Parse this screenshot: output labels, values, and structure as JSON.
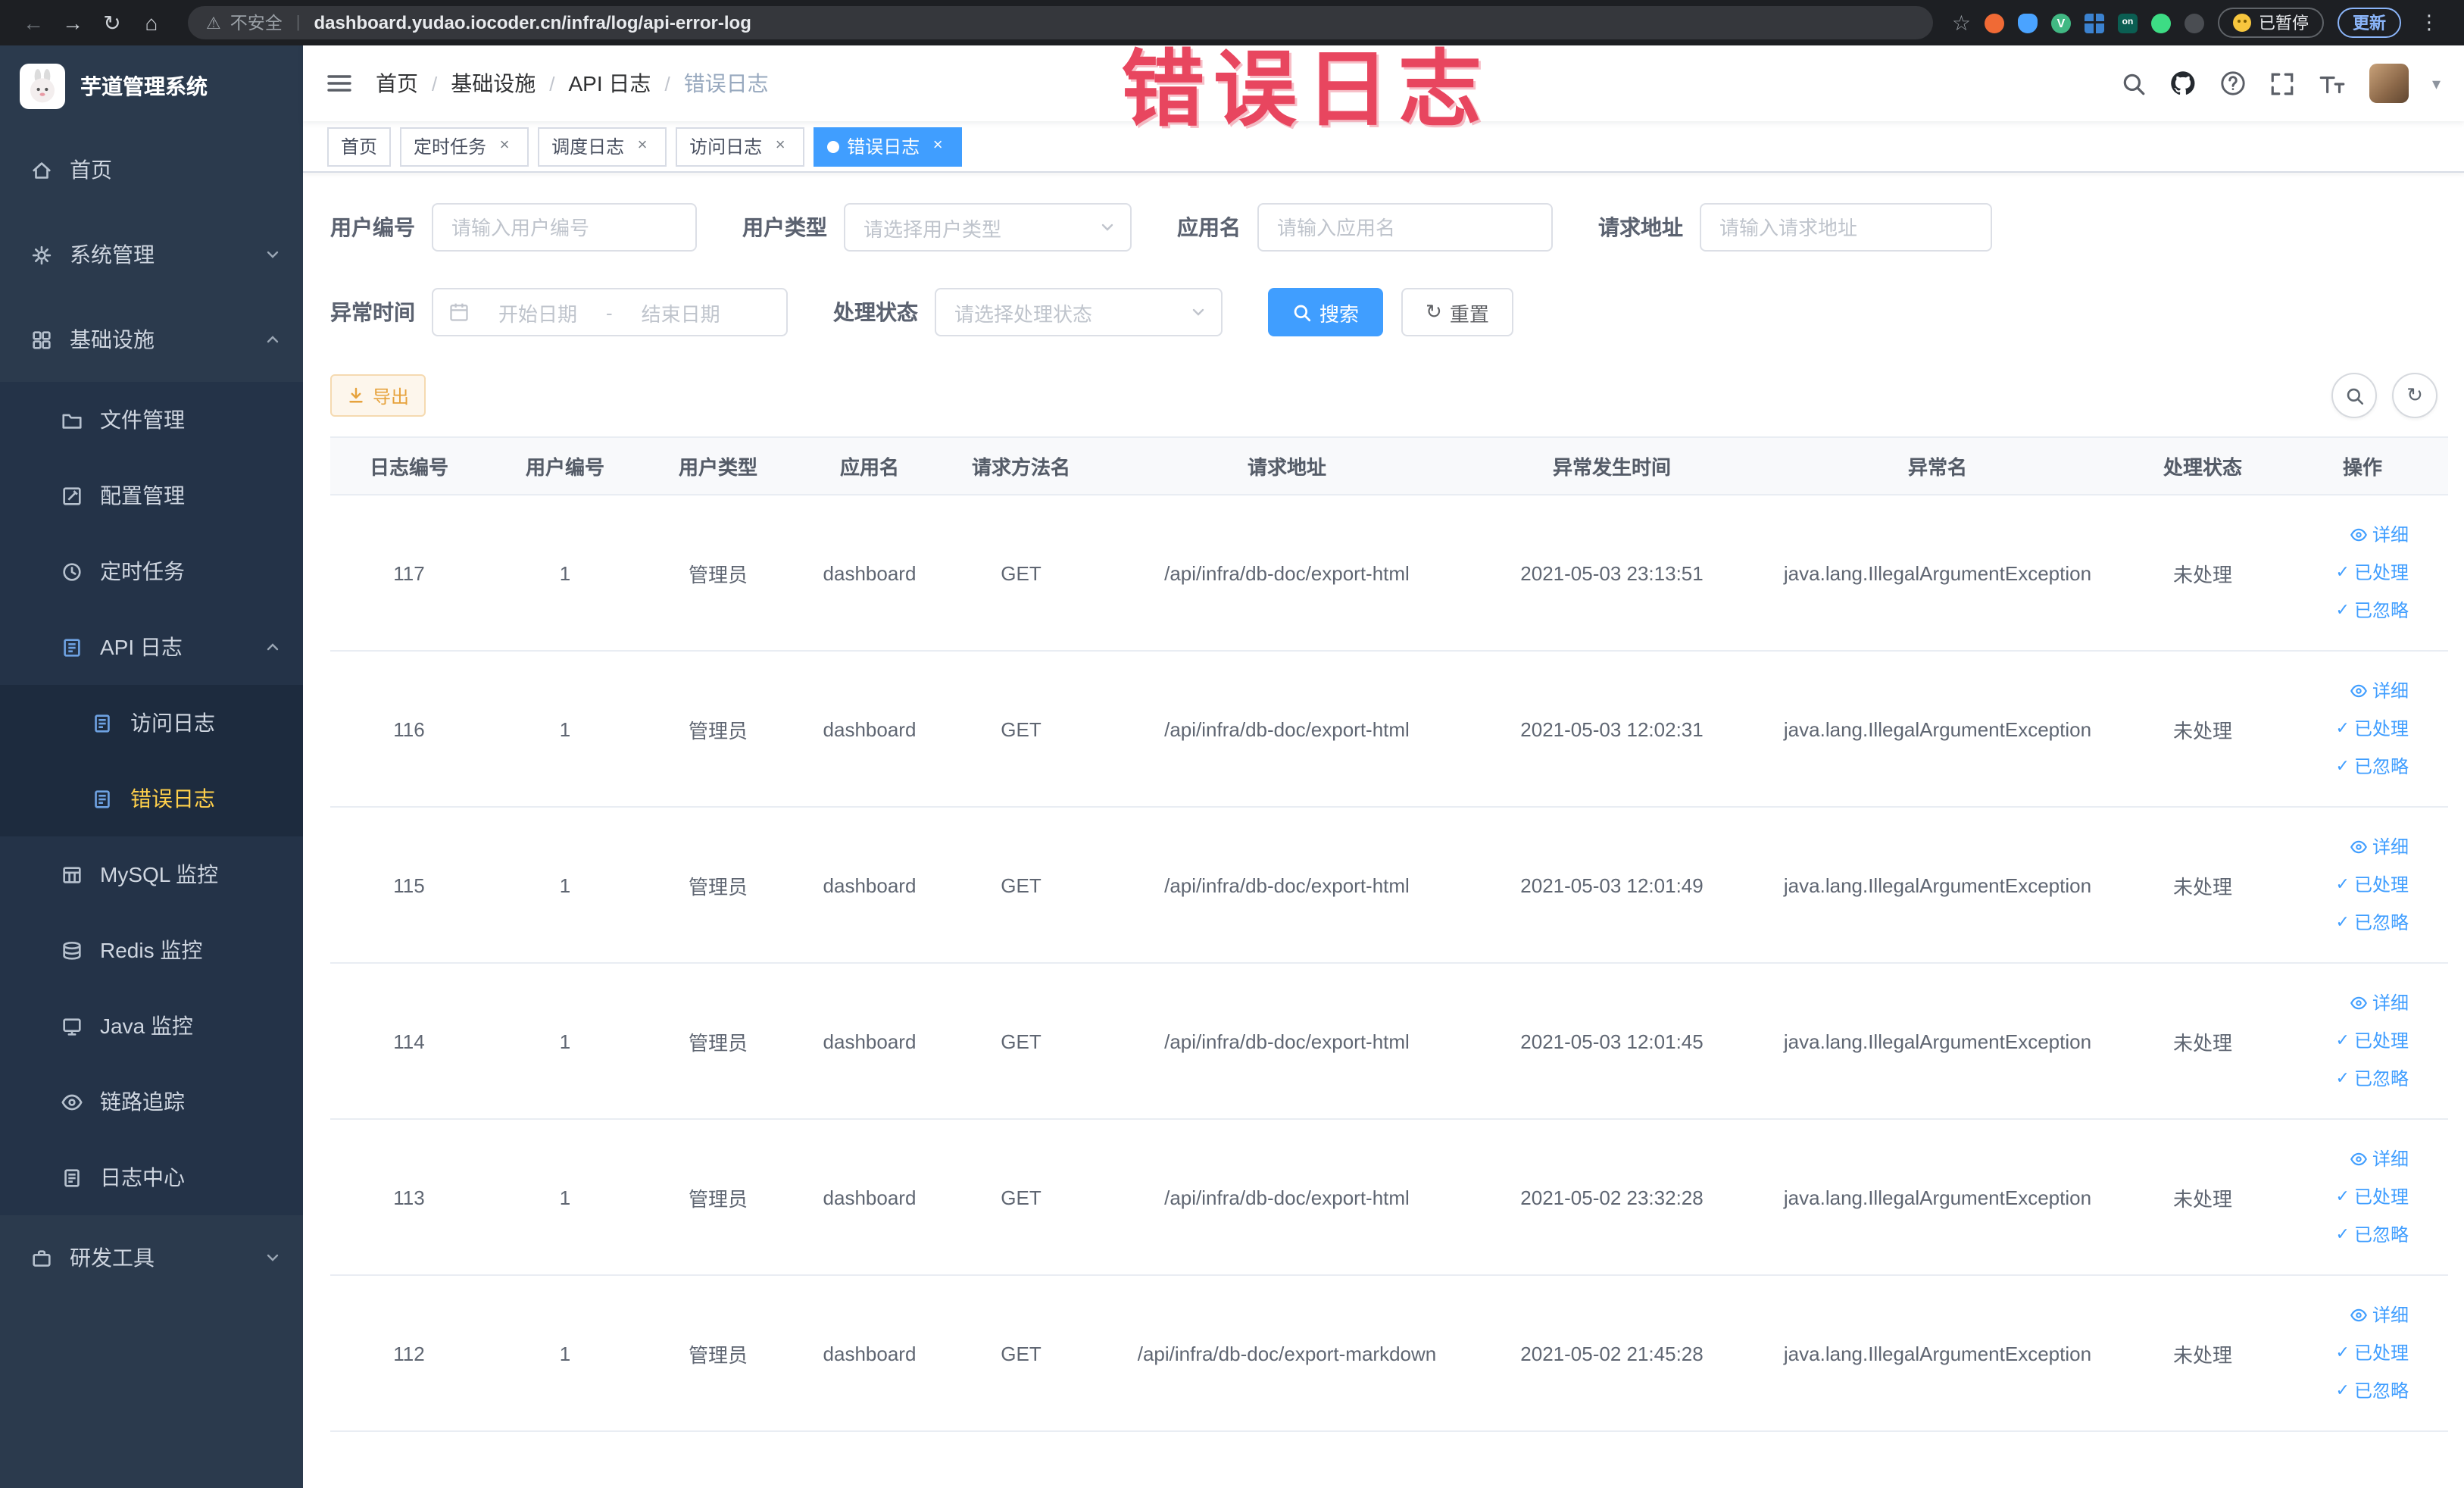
{
  "annotation": {
    "overlay_text": "错误日志"
  },
  "icons": {
    "back": "←",
    "forward": "→",
    "reload": "↻",
    "home": "⌂",
    "star": "☆",
    "warning": "⚠",
    "divider": "|",
    "menu_dots": "⋮",
    "caret_down": "▾",
    "close": "×",
    "check": "✓",
    "slash": "/"
  },
  "browser": {
    "security_label": "不安全",
    "url": "dashboard.yudao.iocoder.cn/infra/log/api-error-log",
    "paused_badge": "已暂停",
    "update_label": "更新",
    "extensions": {
      "v": "V",
      "on": "on"
    }
  },
  "sidebar": {
    "logo_title": "芋道管理系统",
    "items": [
      {
        "label": "首页"
      },
      {
        "label": "系统管理"
      },
      {
        "label": "基础设施"
      },
      {
        "label": "文件管理"
      },
      {
        "label": "配置管理"
      },
      {
        "label": "定时任务"
      },
      {
        "label": "API 日志"
      },
      {
        "label": "访问日志"
      },
      {
        "label": "错误日志"
      },
      {
        "label": "MySQL 监控"
      },
      {
        "label": "Redis 监控"
      },
      {
        "label": "Java 监控"
      },
      {
        "label": "链路追踪"
      },
      {
        "label": "日志中心"
      },
      {
        "label": "研发工具"
      }
    ]
  },
  "breadcrumb": {
    "items": [
      "首页",
      "基础设施",
      "API 日志",
      "错误日志"
    ]
  },
  "tabs": [
    {
      "label": "首页"
    },
    {
      "label": "定时任务"
    },
    {
      "label": "调度日志"
    },
    {
      "label": "访问日志"
    },
    {
      "label": "错误日志"
    }
  ],
  "filters": {
    "user_id_label": "用户编号",
    "user_id_placeholder": "请输入用户编号",
    "user_type_label": "用户类型",
    "user_type_placeholder": "请选择用户类型",
    "app_name_label": "应用名",
    "app_name_placeholder": "请输入应用名",
    "request_url_label": "请求地址",
    "request_url_placeholder": "请输入请求地址",
    "exception_time_label": "异常时间",
    "date_start_placeholder": "开始日期",
    "date_end_placeholder": "结束日期",
    "date_separator": "-",
    "process_status_label": "处理状态",
    "process_status_placeholder": "请选择处理状态",
    "search_label": "搜索",
    "reset_label": "重置"
  },
  "toolbar": {
    "export_label": "导出"
  },
  "table": {
    "columns": [
      "日志编号",
      "用户编号",
      "用户类型",
      "应用名",
      "请求方法名",
      "请求地址",
      "异常发生时间",
      "异常名",
      "处理状态",
      "操作"
    ],
    "row_actions": {
      "detail": "详细",
      "processed": "已处理",
      "ignored": "已忽略"
    },
    "rows": [
      {
        "log_id": "117",
        "user_id": "1",
        "user_type": "管理员",
        "app_name": "dashboard",
        "method": "GET",
        "url": "/api/infra/db-doc/export-html",
        "time": "2021-05-03 23:13:51",
        "exception": "java.lang.IllegalArgumentException",
        "status": "未处理"
      },
      {
        "log_id": "116",
        "user_id": "1",
        "user_type": "管理员",
        "app_name": "dashboard",
        "method": "GET",
        "url": "/api/infra/db-doc/export-html",
        "time": "2021-05-03 12:02:31",
        "exception": "java.lang.IllegalArgumentException",
        "status": "未处理"
      },
      {
        "log_id": "115",
        "user_id": "1",
        "user_type": "管理员",
        "app_name": "dashboard",
        "method": "GET",
        "url": "/api/infra/db-doc/export-html",
        "time": "2021-05-03 12:01:49",
        "exception": "java.lang.IllegalArgumentException",
        "status": "未处理"
      },
      {
        "log_id": "114",
        "user_id": "1",
        "user_type": "管理员",
        "app_name": "dashboard",
        "method": "GET",
        "url": "/api/infra/db-doc/export-html",
        "time": "2021-05-03 12:01:45",
        "exception": "java.lang.IllegalArgumentException",
        "status": "未处理"
      },
      {
        "log_id": "113",
        "user_id": "1",
        "user_type": "管理员",
        "app_name": "dashboard",
        "method": "GET",
        "url": "/api/infra/db-doc/export-html",
        "time": "2021-05-02 23:32:28",
        "exception": "java.lang.IllegalArgumentException",
        "status": "未处理"
      },
      {
        "log_id": "112",
        "user_id": "1",
        "user_type": "管理员",
        "app_name": "dashboard",
        "method": "GET",
        "url": "/api/infra/db-doc/export-markdown",
        "time": "2021-05-02 21:45:28",
        "exception": "java.lang.IllegalArgumentException",
        "status": "未处理"
      }
    ]
  },
  "colors": {
    "accent": "#409eff",
    "sidebar_bg": "#2b3a4d",
    "sidebar_active": "#ffd04b",
    "warning_button": "#e6a23c",
    "annotation": "#e8465f"
  }
}
